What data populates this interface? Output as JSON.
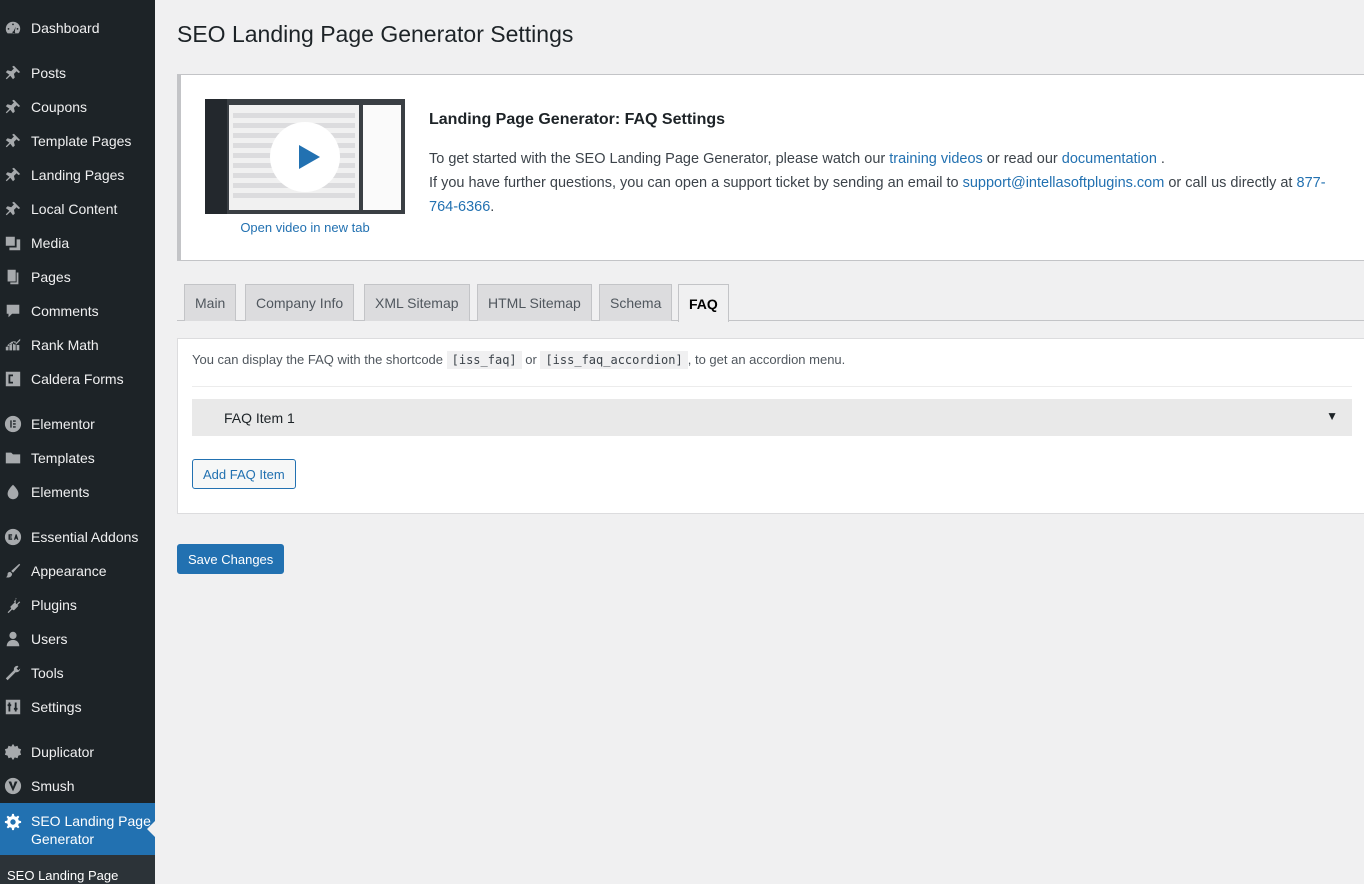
{
  "sidebar": {
    "items": [
      {
        "label": "Dashboard",
        "icon": "dashboard-icon"
      },
      {
        "label": "Posts",
        "icon": "pin-icon"
      },
      {
        "label": "Coupons",
        "icon": "pin-icon"
      },
      {
        "label": "Template Pages",
        "icon": "pin-icon"
      },
      {
        "label": "Landing Pages",
        "icon": "pin-icon"
      },
      {
        "label": "Local Content",
        "icon": "pin-icon"
      },
      {
        "label": "Media",
        "icon": "media-icon"
      },
      {
        "label": "Pages",
        "icon": "pages-icon"
      },
      {
        "label": "Comments",
        "icon": "comments-icon"
      },
      {
        "label": "Rank Math",
        "icon": "rank-math-icon"
      },
      {
        "label": "Caldera Forms",
        "icon": "caldera-icon"
      },
      {
        "label": "Elementor",
        "icon": "elementor-icon"
      },
      {
        "label": "Templates",
        "icon": "folder-icon"
      },
      {
        "label": "Elements",
        "icon": "elements-icon"
      },
      {
        "label": "Essential Addons",
        "icon": "essential-addons-icon"
      },
      {
        "label": "Appearance",
        "icon": "brush-icon"
      },
      {
        "label": "Plugins",
        "icon": "plug-icon"
      },
      {
        "label": "Users",
        "icon": "user-icon"
      },
      {
        "label": "Tools",
        "icon": "wrench-icon"
      },
      {
        "label": "Settings",
        "icon": "settings-icon"
      },
      {
        "label": "Duplicator",
        "icon": "duplicator-icon"
      },
      {
        "label": "Smush",
        "icon": "smush-icon"
      },
      {
        "label": "SEO Landing Page Generator",
        "icon": "gear-icon"
      }
    ],
    "submenu_label": "SEO Landing Page"
  },
  "page": {
    "title": "SEO Landing Page Generator Settings"
  },
  "info": {
    "video_link": "Open video in new tab",
    "title": "Landing Page Generator: FAQ Settings",
    "line1_pre": "To get started with the SEO Landing Page Generator, please watch our ",
    "line1_link1": "training videos",
    "line1_mid": " or read our ",
    "line1_link2": "documentation",
    "line1_post": " .",
    "line2_pre": "If you have further questions, you can open a support ticket by sending an email to ",
    "line2_email": "support@intellasoftplugins.com",
    "line2_mid": " or call us directly at ",
    "line2_phone": "877-764-6366",
    "line2_post": "."
  },
  "tabs": [
    "Main",
    "Company Info",
    "XML Sitemap",
    "HTML Sitemap",
    "Schema",
    "FAQ"
  ],
  "active_tab": "FAQ",
  "faq": {
    "note_pre": "You can display the FAQ with the shortcode ",
    "code1": "[iss_faq]",
    "note_mid": " or ",
    "code2": "[iss_faq_accordion]",
    "note_post": ", to get an accordion menu.",
    "items": [
      "FAQ Item 1"
    ],
    "add_label": "Add FAQ Item"
  },
  "save_label": "Save Changes",
  "colors": {
    "sidebar_bg": "#1d2327",
    "accent": "#2271b1",
    "page_bg": "#f0f0f1"
  }
}
